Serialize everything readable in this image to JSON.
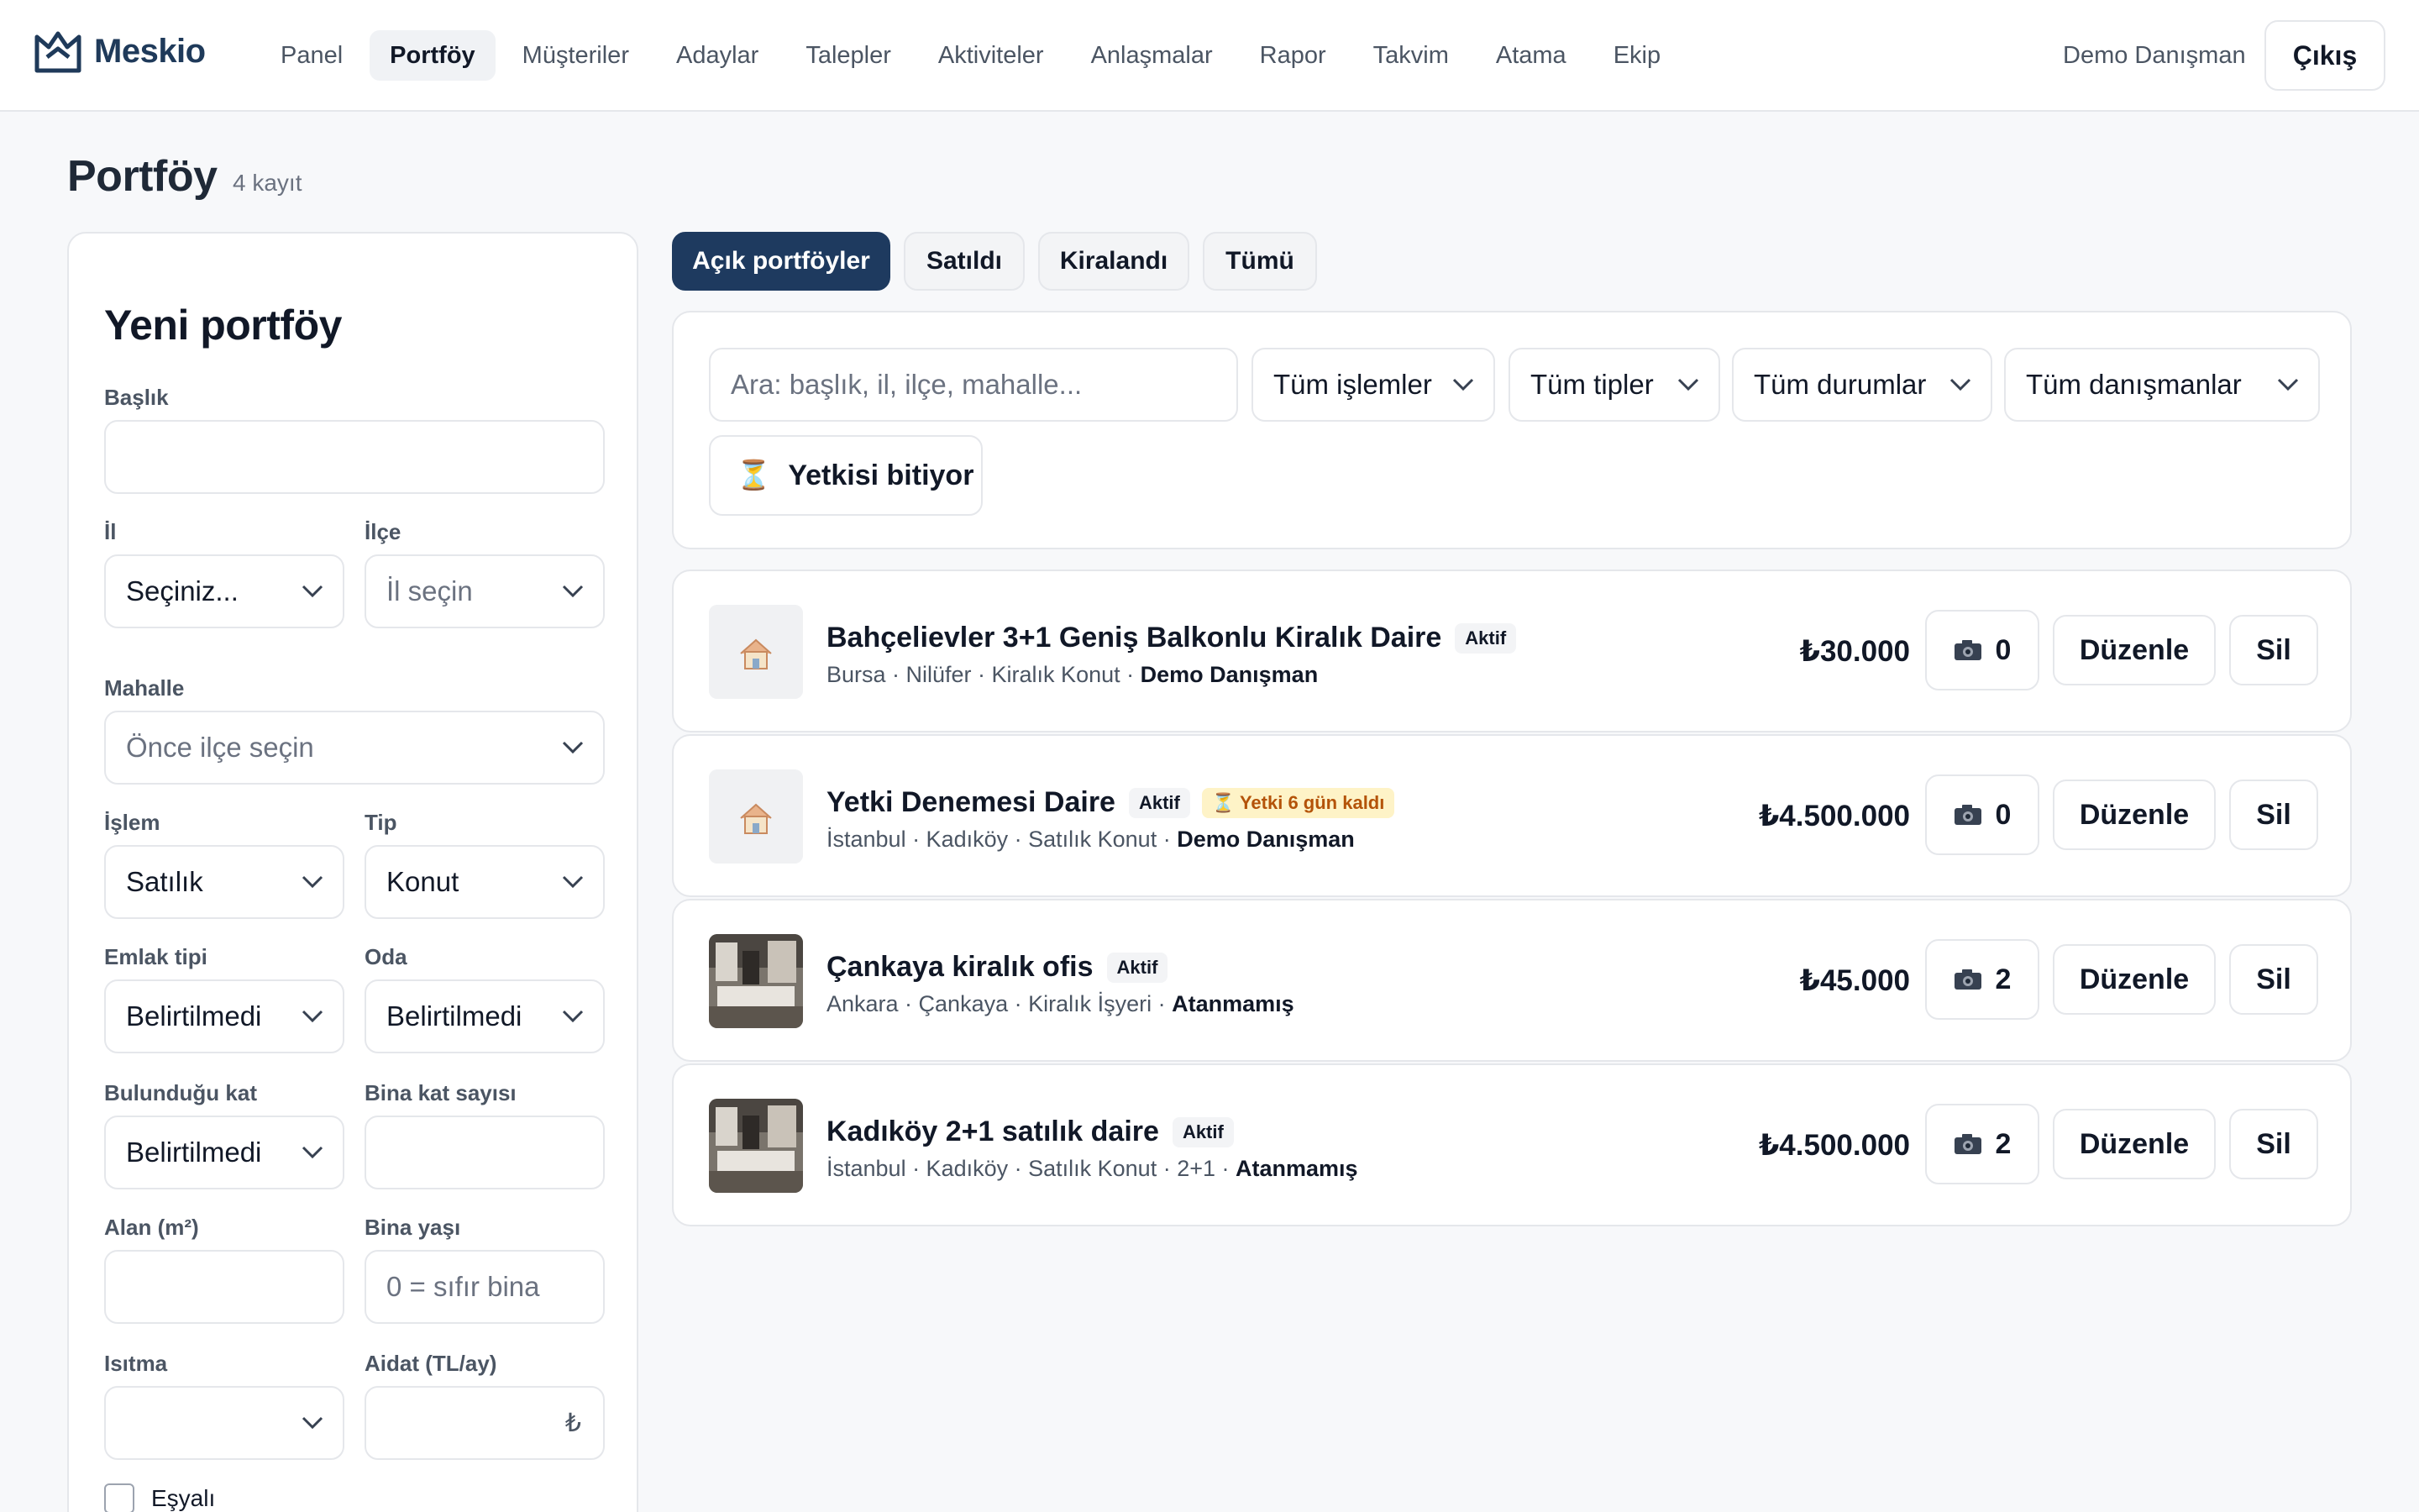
{
  "brand": {
    "name": "Meskio",
    "color": "#1f3a5a"
  },
  "nav": {
    "items": [
      {
        "label": "Panel"
      },
      {
        "label": "Portföy"
      },
      {
        "label": "Müşteriler"
      },
      {
        "label": "Adaylar"
      },
      {
        "label": "Talepler"
      },
      {
        "label": "Aktiviteler"
      },
      {
        "label": "Anlaşmalar"
      },
      {
        "label": "Rapor"
      },
      {
        "label": "Takvim"
      },
      {
        "label": "Atama"
      },
      {
        "label": "Ekip"
      }
    ],
    "active": "Portföy",
    "user": "Demo Danışman",
    "logout": "Çıkış"
  },
  "page": {
    "title": "Portföy",
    "count": "4 kayıt"
  },
  "form": {
    "title": "Yeni portföy",
    "baslik": {
      "label": "Başlık",
      "value": ""
    },
    "il": {
      "label": "İl",
      "value": "Seçiniz..."
    },
    "ilce": {
      "label": "İlçe",
      "placeholder": "İl seçin"
    },
    "mahalle": {
      "label": "Mahalle",
      "placeholder": "Önce ilçe seçin"
    },
    "islem": {
      "label": "İşlem",
      "value": "Satılık"
    },
    "tip": {
      "label": "Tip",
      "value": "Konut"
    },
    "emlak_tipi": {
      "label": "Emlak tipi",
      "value": "Belirtilmedi"
    },
    "oda": {
      "label": "Oda",
      "value": "Belirtilmedi"
    },
    "kat": {
      "label": "Bulunduğu kat",
      "value": "Belirtilmedi"
    },
    "bina_kat": {
      "label": "Bina kat sayısı",
      "value": ""
    },
    "alan": {
      "label": "Alan (m²)",
      "value": ""
    },
    "bina_yasi": {
      "label": "Bina yaşı",
      "placeholder": "0 = sıfır bina"
    },
    "isitma": {
      "label": "Isıtma",
      "value": ""
    },
    "aidat": {
      "label": "Aidat (TL/ay)",
      "suffix": "₺"
    },
    "esyali": {
      "label": "Eşyalı",
      "checked": false
    }
  },
  "tabs": [
    {
      "label": "Açık portföyler",
      "active": true
    },
    {
      "label": "Satıldı",
      "active": false
    },
    {
      "label": "Kiralandı",
      "active": false
    },
    {
      "label": "Tümü",
      "active": false
    }
  ],
  "filters": {
    "search_placeholder": "Ara: başlık, il, ilçe, mahalle...",
    "islem": "Tüm işlemler",
    "tip": "Tüm tipler",
    "durum": "Tüm durumlar",
    "danisman": "Tüm danışmanlar",
    "expiry_button": "Yetkisi bitiyor"
  },
  "listings": [
    {
      "title": "Bahçelievler 3+1 Geniş Balkonlu Kiralık Daire",
      "status": "Aktif",
      "warning": "",
      "location": "Bursa · Nilüfer · Kiralık Konut · ",
      "agent": "Demo Danışman",
      "price": "₺30.000",
      "photos": "0",
      "thumb": "placeholder-house",
      "edit": "Düzenle",
      "delete": "Sil"
    },
    {
      "title": "Yetki Denemesi Daire",
      "status": "Aktif",
      "warning": "Yetki 6 gün kaldı",
      "location": "İstanbul · Kadıköy · Satılık Konut · ",
      "agent": "Demo Danışman",
      "price": "₺4.500.000",
      "photos": "0",
      "thumb": "placeholder-house",
      "edit": "Düzenle",
      "delete": "Sil"
    },
    {
      "title": "Çankaya kiralık ofis",
      "status": "Aktif",
      "warning": "",
      "location": "Ankara · Çankaya · Kiralık İşyeri · ",
      "agent": "Atanmamış",
      "price": "₺45.000",
      "photos": "2",
      "thumb": "interior-photo",
      "edit": "Düzenle",
      "delete": "Sil"
    },
    {
      "title": "Kadıköy 2+1 satılık daire",
      "status": "Aktif",
      "warning": "",
      "location": "İstanbul · Kadıköy · Satılık Konut · 2+1 · ",
      "agent": "Atanmamış",
      "price": "₺4.500.000",
      "photos": "2",
      "thumb": "interior-photo",
      "edit": "Düzenle",
      "delete": "Sil"
    }
  ],
  "colors": {
    "accent": "#1e3a5f",
    "warning_bg": "#fef3c7",
    "warning_text": "#b45309"
  }
}
